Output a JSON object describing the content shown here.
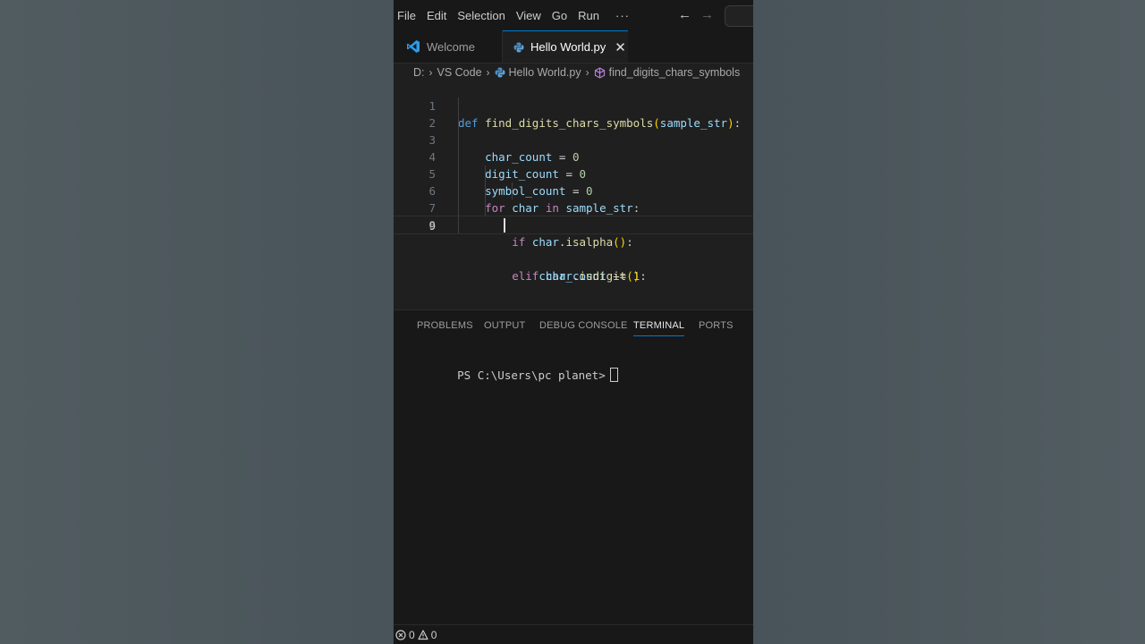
{
  "menu": {
    "items": [
      "File",
      "Edit",
      "Selection",
      "View",
      "Go",
      "Run"
    ],
    "more": "···"
  },
  "nav": {
    "back": "←",
    "forward": "→"
  },
  "tabs": [
    {
      "label": "Welcome",
      "icon": "vscode-logo-icon",
      "active": false
    },
    {
      "label": "Hello World.py",
      "icon": "python-icon",
      "active": true,
      "close": "✕"
    }
  ],
  "breadcrumb": {
    "drive": "D:",
    "folder": "VS Code",
    "file": "Hello World.py",
    "symbol": "find_digits_chars_symbols",
    "sep": "›"
  },
  "editor": {
    "line_numbers": [
      "1",
      "2",
      "3",
      "4",
      "5",
      "6",
      "7",
      "8",
      "9"
    ],
    "current_line": "9"
  },
  "panel": {
    "tabs": [
      "PROBLEMS",
      "OUTPUT",
      "DEBUG CONSOLE",
      "TERMINAL",
      "PORTS"
    ],
    "active_tab": "TERMINAL",
    "terminal_prompt": "PS C:\\Users\\pc planet>"
  },
  "status": {
    "errors": "0",
    "warnings": "0"
  },
  "colors": {
    "accent": "#0078d4",
    "keyword": "#569cd6",
    "control": "#c586c0",
    "function": "#dcdcaa",
    "variable": "#9cdcfe",
    "number": "#b5cea8"
  }
}
